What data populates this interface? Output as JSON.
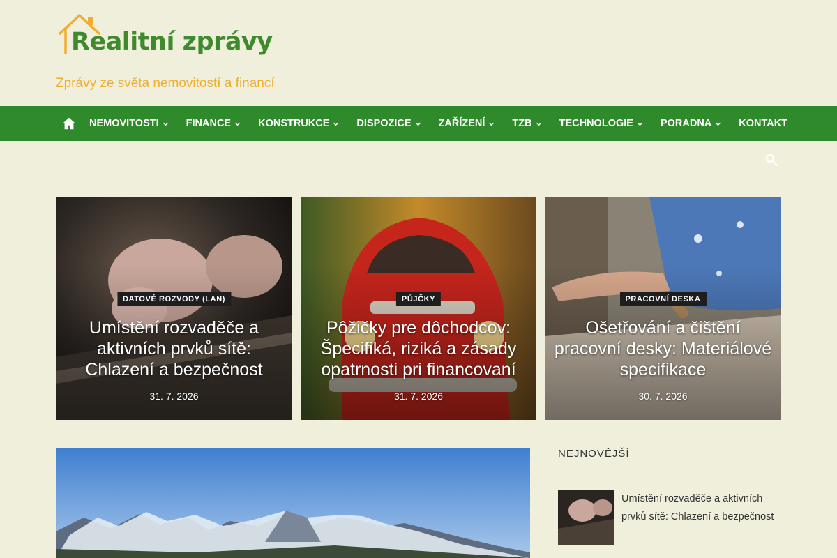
{
  "header": {
    "logo_text": "Realitní zprávy",
    "tagline": "Zprávy ze světa nemovitostí a financí"
  },
  "nav": {
    "home_icon": "home-icon",
    "items": [
      {
        "label": "NEMOVITOSTI",
        "has_dropdown": true
      },
      {
        "label": "FINANCE",
        "has_dropdown": true
      },
      {
        "label": "KONSTRUKCE",
        "has_dropdown": true
      },
      {
        "label": "DISPOZICE",
        "has_dropdown": true
      },
      {
        "label": "ZAŘÍZENÍ",
        "has_dropdown": true
      },
      {
        "label": "TZB",
        "has_dropdown": true
      },
      {
        "label": "TECHNOLOGIE",
        "has_dropdown": true
      },
      {
        "label": "PORADNA",
        "has_dropdown": true
      },
      {
        "label": "KONTAKT",
        "has_dropdown": false
      }
    ],
    "search_icon": "search-icon"
  },
  "featured": [
    {
      "category": "DATOVÉ ROZVODY (LAN)",
      "title": "Umístění rozvaděče a aktivních prvků sítě: Chlazení a bezpečnost",
      "date": "31. 7. 2026"
    },
    {
      "category": "PŮJČKY",
      "title": "Pôžičky pre dôchodcov: Špecifiká, riziká a zásady opatrnosti pri financovaní",
      "date": "31. 7. 2026"
    },
    {
      "category": "PRACOVNÍ DESKA",
      "title": "Ošetřování a čištění pracovní desky: Materiálové specifikace",
      "date": "30. 7. 2026"
    }
  ],
  "sidebar": {
    "title": "NEJNOVĚJŠÍ",
    "items": [
      {
        "title": "Umístění rozvaděče a aktivních prvků sítě: Chlazení a bezpečnost"
      }
    ]
  },
  "colors": {
    "background": "#efefdc",
    "nav": "#2f8a2c",
    "logo_green": "#3f8a2c",
    "accent_orange": "#f0ad2e",
    "badge": "#1e1e1e"
  }
}
